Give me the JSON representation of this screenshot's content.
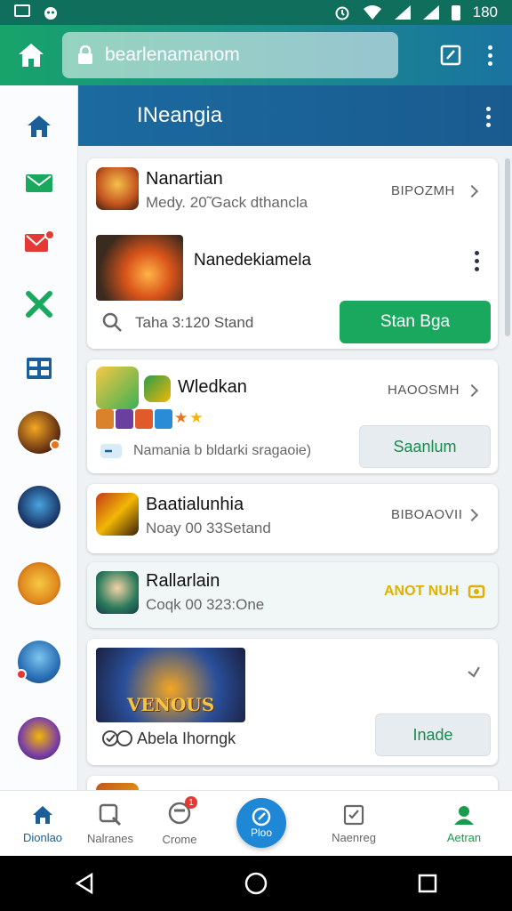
{
  "status_bar": {
    "time": "180"
  },
  "address_bar": {
    "url": "bearlenamanom"
  },
  "section": {
    "title": "INeangia"
  },
  "cards": [
    {
      "title": "Nanartian",
      "subtitle": "Medy. 20̃ Gack dthancla",
      "meta": "BIPOZMH",
      "feature_title": "Nanedekiamela",
      "search_text": "Taha 3:120 Stand",
      "button_label": "Stan Bga"
    },
    {
      "title": "Wledkan",
      "meta": "HAOOSMH",
      "description": "Namania b bldarki sragaoie)",
      "button_label": "Saanlum"
    },
    {
      "title": "Baatialunhia",
      "subtitle": "Noay 00 33Setand",
      "meta": "BIBOAOVII"
    },
    {
      "title": "Rallarlain",
      "subtitle": "Coqk 00 323:One",
      "status": "ANOT NUH"
    },
    {
      "banner_text": "VENOUS",
      "caption": "Abela Ihorngk",
      "button_label": "Inade"
    }
  ],
  "bottom_nav": [
    {
      "label": "Dionlao"
    },
    {
      "label": "Nalranes"
    },
    {
      "label": "Crome",
      "badge": "1"
    },
    {
      "label": "Ploo"
    },
    {
      "label": "Naenreg"
    },
    {
      "label": "Aetran"
    }
  ],
  "colors": {
    "primary_green": "#1aa85f",
    "header_blue": "#1b6aa0",
    "accent_yellow": "#f2b705",
    "active_blue": "#1a5f9a"
  }
}
